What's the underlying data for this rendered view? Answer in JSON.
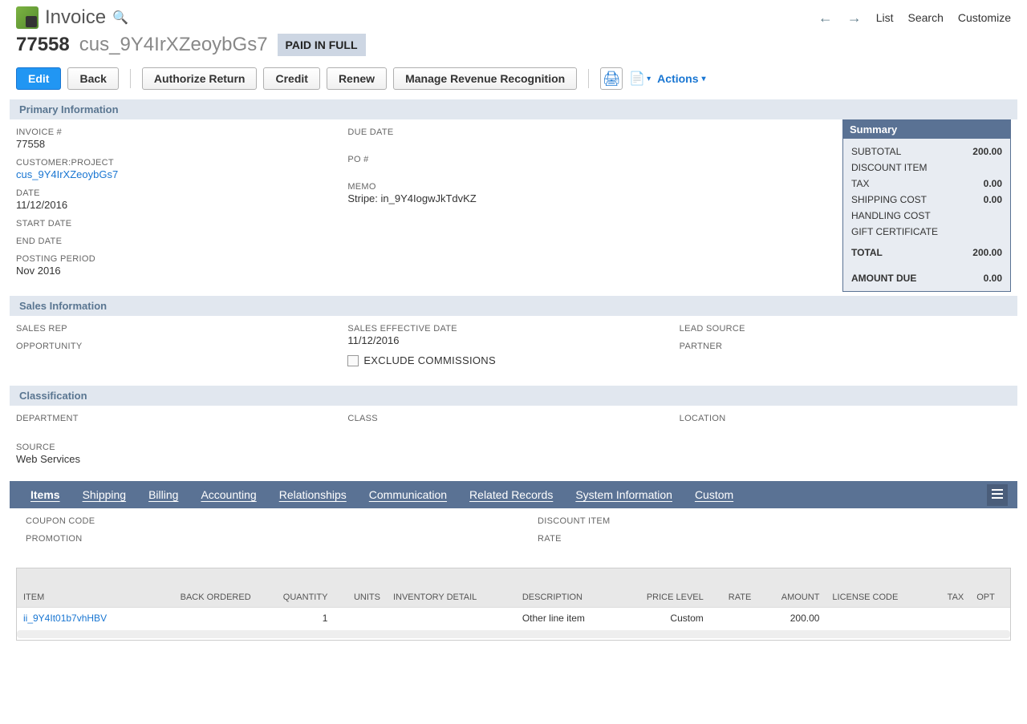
{
  "header": {
    "title": "Invoice",
    "nav": {
      "list": "List",
      "search": "Search",
      "customize": "Customize"
    }
  },
  "record": {
    "id": "77558",
    "name": "cus_9Y4IrXZeoybGs7",
    "status": "PAID IN FULL"
  },
  "toolbar": {
    "edit": "Edit",
    "back": "Back",
    "authorize": "Authorize Return",
    "credit": "Credit",
    "renew": "Renew",
    "mrr": "Manage Revenue Recognition",
    "actions": "Actions"
  },
  "sections": {
    "primary": {
      "title": "Primary Information",
      "labels": {
        "invoice_no": "INVOICE #",
        "customer": "CUSTOMER:PROJECT",
        "date": "DATE",
        "start": "START DATE",
        "end": "END DATE",
        "posting": "POSTING PERIOD",
        "due": "DUE DATE",
        "po": "PO #",
        "memo": "MEMO"
      },
      "values": {
        "invoice_no": "77558",
        "customer": "cus_9Y4IrXZeoybGs7",
        "date": "11/12/2016",
        "posting": "Nov 2016",
        "memo": "Stripe: in_9Y4IogwJkTdvKZ"
      }
    },
    "summary": {
      "title": "Summary",
      "rows": {
        "subtotal": {
          "label": "SUBTOTAL",
          "value": "200.00"
        },
        "discount": {
          "label": "DISCOUNT ITEM",
          "value": ""
        },
        "tax": {
          "label": "TAX",
          "value": "0.00"
        },
        "shipping": {
          "label": "SHIPPING COST",
          "value": "0.00"
        },
        "handling": {
          "label": "HANDLING COST",
          "value": ""
        },
        "gift": {
          "label": "GIFT CERTIFICATE",
          "value": ""
        },
        "total": {
          "label": "TOTAL",
          "value": "200.00"
        },
        "due": {
          "label": "AMOUNT DUE",
          "value": "0.00"
        }
      }
    },
    "sales": {
      "title": "Sales Information",
      "labels": {
        "rep": "SALES REP",
        "opportunity": "OPPORTUNITY",
        "effective": "SALES EFFECTIVE DATE",
        "exclude": "EXCLUDE COMMISSIONS",
        "lead": "LEAD SOURCE",
        "partner": "PARTNER"
      },
      "values": {
        "effective": "11/12/2016"
      }
    },
    "classification": {
      "title": "Classification",
      "labels": {
        "dept": "DEPARTMENT",
        "class": "CLASS",
        "location": "LOCATION"
      }
    },
    "source": {
      "label": "SOURCE",
      "value": "Web Services"
    }
  },
  "tabs": [
    "Items",
    "Shipping",
    "Billing",
    "Accounting",
    "Relationships",
    "Communication",
    "Related Records",
    "System Information",
    "Custom"
  ],
  "items_sub": {
    "coupon": "COUPON CODE",
    "promotion": "PROMOTION",
    "discount_item": "DISCOUNT ITEM",
    "rate": "RATE"
  },
  "items_table": {
    "headers": {
      "item": "ITEM",
      "back": "BACK ORDERED",
      "qty": "QUANTITY",
      "units": "UNITS",
      "inv": "INVENTORY DETAIL",
      "desc": "DESCRIPTION",
      "price": "PRICE LEVEL",
      "rate": "RATE",
      "amount": "AMOUNT",
      "license": "LICENSE CODE",
      "tax": "TAX",
      "opt": "OPT"
    },
    "rows": [
      {
        "item": "ii_9Y4It01b7vhHBV",
        "qty": "1",
        "desc": "Other line item",
        "price": "Custom",
        "amount": "200.00"
      }
    ]
  }
}
